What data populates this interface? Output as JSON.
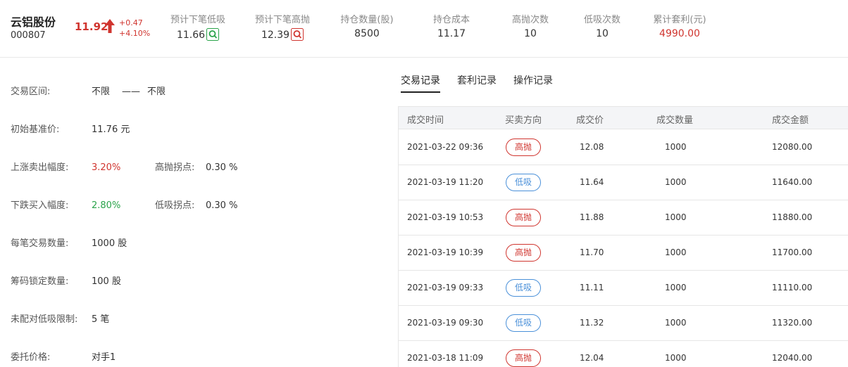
{
  "stock": {
    "name": "云铝股份",
    "code": "000807",
    "price": "11.92",
    "change": "+0.47",
    "change_pct": "+4.10%"
  },
  "stats": [
    {
      "label": "预计下笔低吸",
      "value": "11.66",
      "icon": "search-green-icon"
    },
    {
      "label": "预计下笔高抛",
      "value": "12.39",
      "icon": "search-red-icon"
    },
    {
      "label": "持仓数量(股)",
      "value": "8500"
    },
    {
      "label": "持仓成本",
      "value": "11.17"
    },
    {
      "label": "高抛次数",
      "value": "10"
    },
    {
      "label": "低吸次数",
      "value": "10"
    },
    {
      "label": "累计套利(元)",
      "value": "4990.00"
    }
  ],
  "params": {
    "range_label": "交易区间:",
    "range_low": "不限",
    "range_dash": "——",
    "range_high": "不限",
    "base_label": "初始基准价:",
    "base_value": "11.76 元",
    "rise_label": "上涨卖出幅度:",
    "rise_value": "3.20%",
    "high_turn_label": "高抛拐点:",
    "high_turn_value": "0.30 %",
    "fall_label": "下跌买入幅度:",
    "fall_value": "2.80%",
    "low_turn_label": "低吸拐点:",
    "low_turn_value": "0.30 %",
    "qty_label": "每笔交易数量:",
    "qty_value": "1000 股",
    "lock_label": "筹码锁定数量:",
    "lock_value": "100 股",
    "unmatched_label": "未配对低吸限制:",
    "unmatched_value": "5 笔",
    "order_price_label": "委托价格:",
    "order_price_value": "对手1"
  },
  "tabs": [
    "交易记录",
    "套利记录",
    "操作记录"
  ],
  "table": {
    "headers": [
      "成交时间",
      "买卖方向",
      "成交价",
      "成交数量",
      "成交金额"
    ],
    "rows": [
      {
        "time": "2021-03-22 09:36",
        "dir": "高抛",
        "price": "12.08",
        "qty": "1000",
        "amount": "12080.00"
      },
      {
        "time": "2021-03-19 11:20",
        "dir": "低吸",
        "price": "11.64",
        "qty": "1000",
        "amount": "11640.00"
      },
      {
        "time": "2021-03-19 10:53",
        "dir": "高抛",
        "price": "11.88",
        "qty": "1000",
        "amount": "11880.00"
      },
      {
        "time": "2021-03-19 10:39",
        "dir": "高抛",
        "price": "11.70",
        "qty": "1000",
        "amount": "11700.00"
      },
      {
        "time": "2021-03-19 09:33",
        "dir": "低吸",
        "price": "11.11",
        "qty": "1000",
        "amount": "11110.00"
      },
      {
        "time": "2021-03-19 09:30",
        "dir": "低吸",
        "price": "11.32",
        "qty": "1000",
        "amount": "11320.00"
      },
      {
        "time": "2021-03-18 11:09",
        "dir": "高抛",
        "price": "12.04",
        "qty": "1000",
        "amount": "12040.00"
      }
    ]
  },
  "colors": {
    "up_red": "#d0352f",
    "down_green": "#2aa34a",
    "buy_blue": "#4a90d9"
  }
}
